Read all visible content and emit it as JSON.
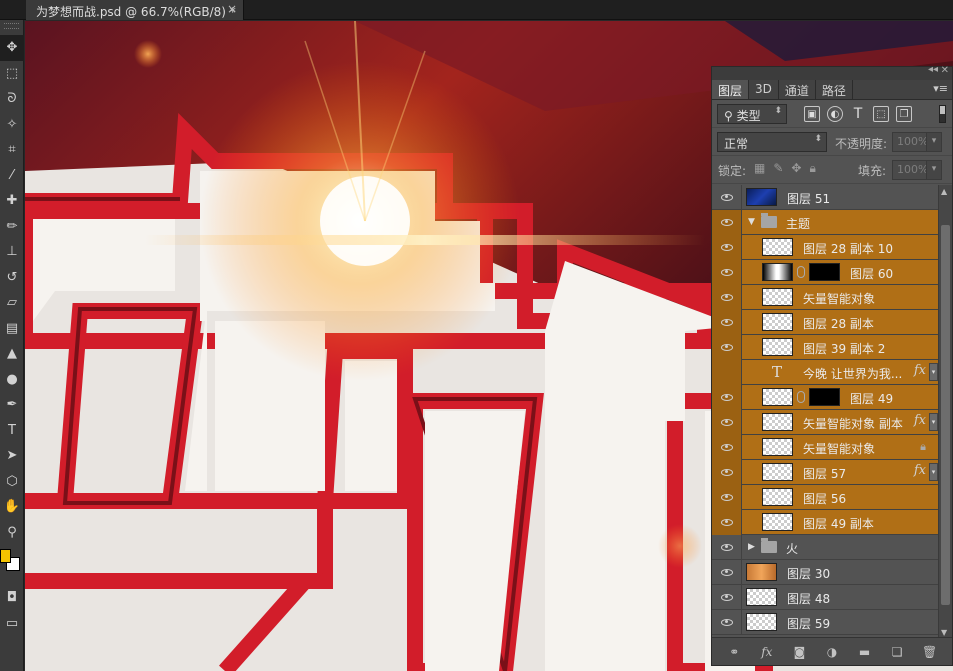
{
  "document": {
    "tab_title": "为梦想而战.psd @ 66.7%(RGB/8) *",
    "close_glyph": "×"
  },
  "toolbar": {
    "tools": [
      "move-tool-icon",
      "marquee-tool-icon",
      "lasso-tool-icon",
      "magic-wand-icon",
      "crop-tool-icon",
      "eyedropper-icon",
      "healing-brush-icon",
      "brush-tool-icon",
      "clone-stamp-icon",
      "history-brush-icon",
      "eraser-icon",
      "gradient-tool-icon",
      "blur-tool-icon",
      "dodge-tool-icon",
      "pen-tool-icon",
      "type-tool-icon",
      "path-selection-icon",
      "shape-tool-icon",
      "hand-tool-icon",
      "zoom-tool-icon"
    ],
    "foreground_color": "#f5c400",
    "background_color": "#ffffff"
  },
  "layers_panel": {
    "tabs": [
      "图层",
      "3D",
      "通道",
      "路径"
    ],
    "filter_kind": "类型",
    "blend_mode": "正常",
    "opacity_label": "不透明度:",
    "opacity_value": "100%",
    "lock_label": "锁定:",
    "fill_label": "填充:",
    "fill_value": "100%",
    "layers": [
      {
        "name": "图层 51",
        "thumb": "blue",
        "visible": true,
        "selected": false,
        "indent": 0
      },
      {
        "name": "主题",
        "type": "group",
        "expanded": true,
        "visible": true,
        "selected": true,
        "indent": 0
      },
      {
        "name": "图层 28 副本 10",
        "thumb": "checker",
        "visible": true,
        "selected": true,
        "indent": 1
      },
      {
        "name": "图层 60",
        "thumb": "dark-line",
        "mask": true,
        "visible": true,
        "selected": true,
        "indent": 1
      },
      {
        "name": "矢量智能对象",
        "thumb": "checker",
        "visible": true,
        "selected": true,
        "indent": 1
      },
      {
        "name": "图层 28 副本",
        "thumb": "checker",
        "visible": true,
        "selected": true,
        "indent": 1
      },
      {
        "name": "图层 39 副本 2",
        "thumb": "checker",
        "visible": true,
        "selected": true,
        "indent": 1
      },
      {
        "name": "今晚 让世界为我...",
        "type": "text",
        "fx": true,
        "visible": false,
        "selected": true,
        "indent": 1
      },
      {
        "name": "图层 49",
        "thumb": "checker",
        "mask": true,
        "visible": true,
        "selected": true,
        "indent": 1
      },
      {
        "name": "矢量智能对象 副本",
        "thumb": "checker",
        "fx": true,
        "visible": true,
        "selected": true,
        "indent": 1
      },
      {
        "name": "矢量智能对象",
        "thumb": "checker",
        "locked": true,
        "visible": true,
        "selected": true,
        "indent": 1
      },
      {
        "name": "图层 57",
        "thumb": "checker",
        "fx": true,
        "visible": true,
        "selected": true,
        "indent": 1
      },
      {
        "name": "图层 56",
        "thumb": "checker",
        "visible": true,
        "selected": true,
        "indent": 1
      },
      {
        "name": "图层 49 副本",
        "thumb": "checker",
        "visible": true,
        "selected": true,
        "indent": 1
      },
      {
        "name": "火",
        "type": "group",
        "expanded": false,
        "visible": true,
        "selected": false,
        "indent": 0
      },
      {
        "name": "图层 30",
        "thumb": "orange",
        "visible": true,
        "selected": false,
        "indent": 0
      },
      {
        "name": "图层 48",
        "thumb": "checker",
        "visible": true,
        "selected": false,
        "indent": 0
      },
      {
        "name": "图层 59",
        "thumb": "checker",
        "visible": true,
        "selected": false,
        "indent": 0
      }
    ],
    "fx_label": "fx",
    "footer_icons": [
      "link-icon",
      "fx-icon",
      "mask-icon",
      "adjustment-icon",
      "group-icon",
      "new-layer-icon",
      "trash-icon"
    ]
  },
  "colors": {
    "selected_row": "#b06f16",
    "panel_bg": "#535353",
    "accent_red": "#d21d2a"
  }
}
